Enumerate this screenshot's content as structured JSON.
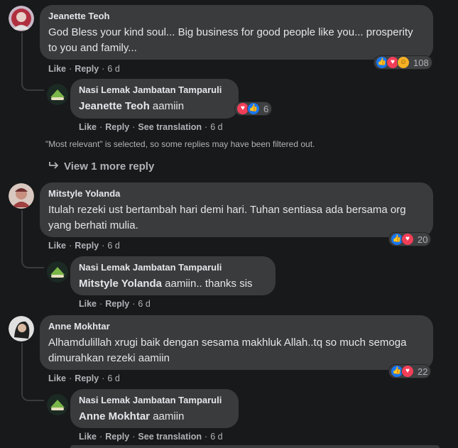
{
  "colors": {
    "background": "#18191a",
    "bubble": "#3a3b3c",
    "like": "#1877f2",
    "love": "#f33e58",
    "care": "#f7b125"
  },
  "comments": [
    {
      "author": "Jeanette Teoh",
      "text": "God Bless your kind soul... Big business for good people like you... prosperity to you and family...",
      "reaction_icons": [
        "like-icon",
        "love-icon",
        "care-icon"
      ],
      "reaction_count": "108",
      "like": "Like",
      "reply": "Reply",
      "time": "6 d",
      "replies": [
        {
          "author": "Nasi Lemak Jambatan Tamparuli",
          "mention": "Jeanette Teoh",
          "text": "aamiin",
          "reaction_icons": [
            "love-icon",
            "like-icon"
          ],
          "reaction_count": "6",
          "like": "Like",
          "reply": "Reply",
          "translate": "See translation",
          "time": "6 d"
        }
      ],
      "filter_note": "\"Most relevant\" is selected, so some replies may have been filtered out.",
      "more_replies": "View 1 more reply"
    },
    {
      "author": "Mitstyle Yolanda",
      "text": "Itulah rezeki ust bertambah hari demi hari. Tuhan sentiasa ada bersama org yang berhati mulia.",
      "reaction_icons": [
        "like-icon",
        "love-icon"
      ],
      "reaction_count": "20",
      "like": "Like",
      "reply": "Reply",
      "time": "6 d",
      "replies": [
        {
          "author": "Nasi Lemak Jambatan Tamparuli",
          "mention": "Mitstyle Yolanda",
          "text": "aamiin.. thanks sis",
          "like": "Like",
          "reply": "Reply",
          "time": "6 d"
        }
      ]
    },
    {
      "author": "Anne Mokhtar",
      "text": "Alhamdulillah xrugi baik dengan sesama makhluk Allah..tq so much semoga dimurahkan rezeki aamiin",
      "reaction_icons": [
        "like-icon",
        "love-icon"
      ],
      "reaction_count": "22",
      "like": "Like",
      "reply": "Reply",
      "time": "6 d",
      "replies": [
        {
          "author": "Nasi Lemak Jambatan Tamparuli",
          "mention": "Anne Mokhtar",
          "text": "aamiin",
          "like": "Like",
          "reply": "Reply",
          "translate": "See translation",
          "time": "6 d"
        }
      ]
    }
  ]
}
